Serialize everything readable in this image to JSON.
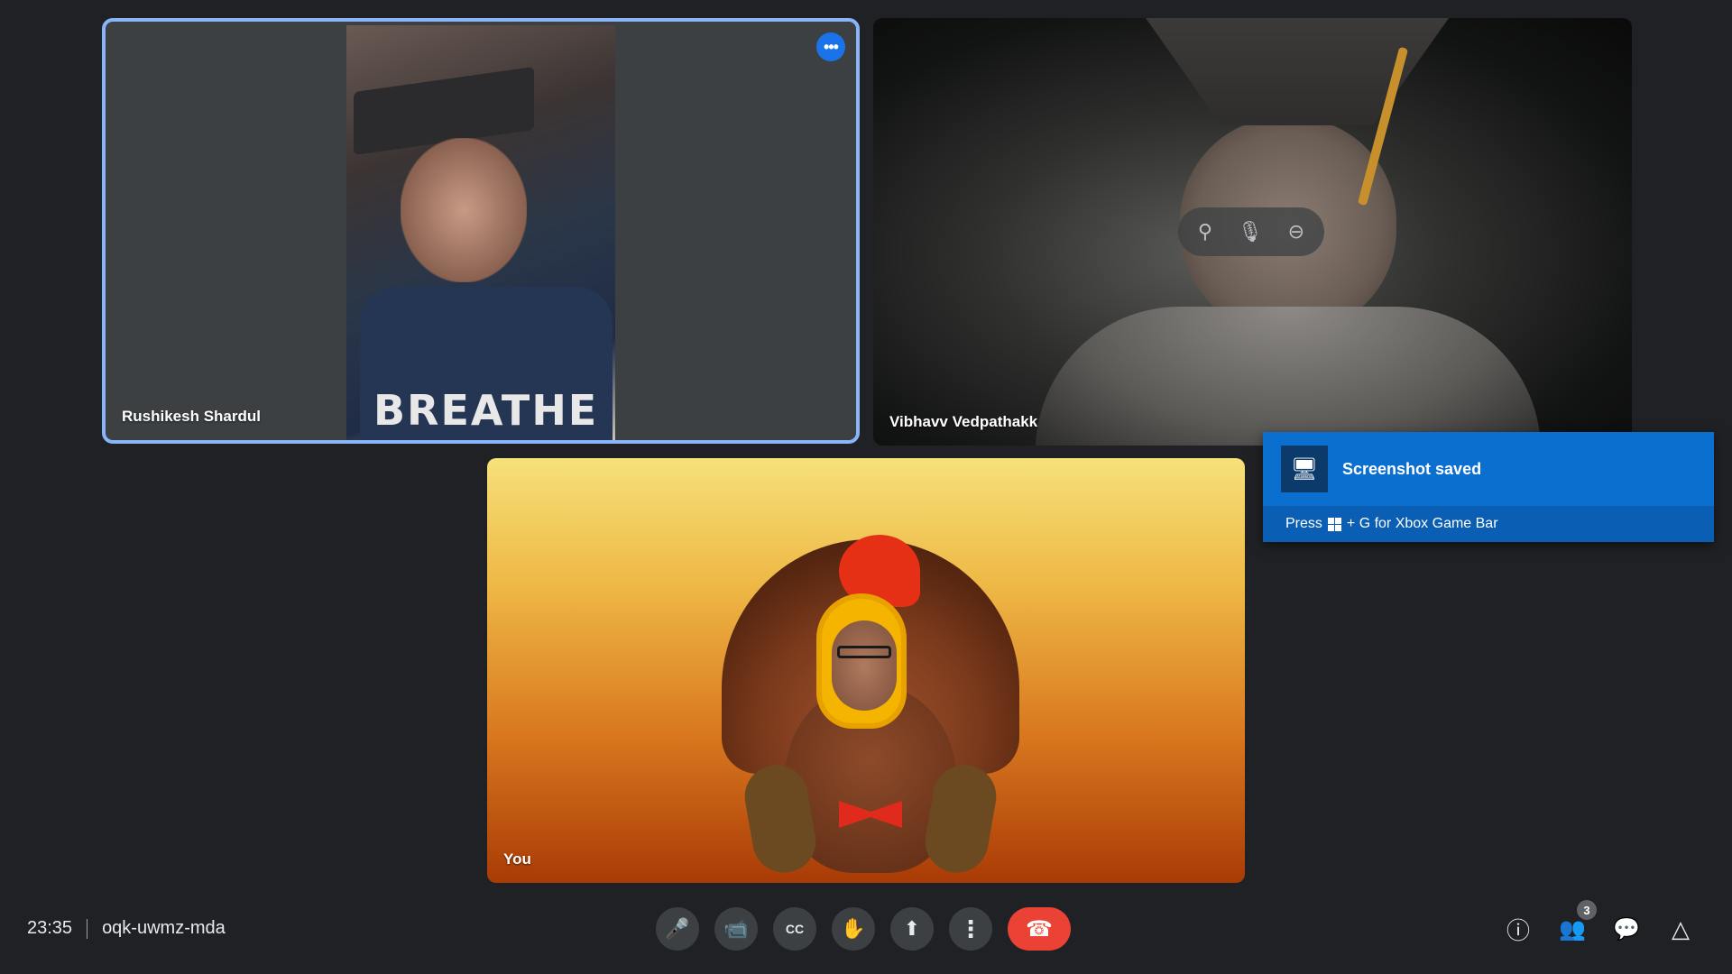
{
  "tiles": {
    "tile1": {
      "name": "Rushikesh Shardul",
      "shirt_text": "BREATHE"
    },
    "tile2": {
      "name": "Vibhavv Vedpathakk"
    },
    "tile3": {
      "name": "You"
    }
  },
  "tile1_more_label": "•••",
  "hover_controls": {
    "pin": "⚲",
    "mute": "🎙",
    "remove": "⊖"
  },
  "toast": {
    "title": "Screenshot saved",
    "hint_prefix": "Press",
    "hint_suffix": "+ G for Xbox Game Bar",
    "icon": "gamebar-icon"
  },
  "meeting": {
    "time": "23:35",
    "code": "oqk-uwmz-mda"
  },
  "controls": {
    "mic": "🎤",
    "camera": "📹",
    "captions": "CC",
    "raise_hand": "✋",
    "present": "⬆",
    "more": "⋮",
    "end_call": "☎"
  },
  "right_tools": {
    "info": "ⓘ",
    "people": "👥",
    "people_count": "3",
    "chat": "💬",
    "activities": "△"
  },
  "colors": {
    "accent": "#8ab4f8",
    "end_call": "#ea4335",
    "toast_bg": "#0b6fd0"
  }
}
